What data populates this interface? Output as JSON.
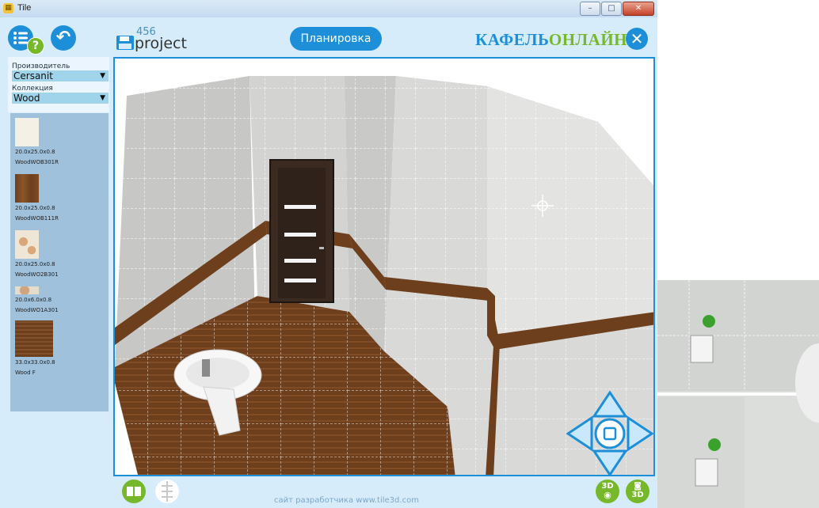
{
  "window": {
    "title": "Tile",
    "minimize_glyph": "–",
    "maximize_glyph": "□",
    "close_glyph": "✕",
    "icon": "tile-app-icon"
  },
  "toolbar": {
    "menu_icon": "list-menu-icon",
    "help_glyph": "?",
    "back_icon": "undo-arrow-icon",
    "back_glyph": "↶",
    "save_icon": "floppy-save-icon",
    "project_number": "456",
    "project_name": "project",
    "plan_button": "Планировка",
    "brand_part1": "КАФЕЛЬ",
    "brand_part2": "ОНЛАЙН",
    "close_icon": "close-circle-icon",
    "close_glyph": "✕"
  },
  "filters": {
    "manufacturer_label": "Производитель",
    "manufacturer_value": "Cersanit",
    "collection_label": "Коллекция",
    "collection_value": "Wood",
    "dropdown_glyph": "▼"
  },
  "tiles": [
    {
      "size": "20.0x25.0x0.8",
      "name": "WoodWOB301R",
      "color": "#f4f0e6"
    },
    {
      "size": "20.0x25.0x0.8",
      "name": "WoodWOB111R",
      "color": "#7a4a22"
    },
    {
      "size": "20.0x25.0x0.8",
      "name": "WoodWO2B301",
      "color": "#e8dcc6"
    },
    {
      "size": "20.0x6.0x0.8",
      "name": "WoodWO1A301",
      "color": "#e6dccc"
    },
    {
      "size": "33.0x33.0x0.8",
      "name": "Wood F",
      "color": "#7a4a22"
    }
  ],
  "viewport": {
    "description_icon": "3d-room-view",
    "nav_icon": "navigation-arrows-icon"
  },
  "bottom": {
    "footer_text": "сайт разработчика www.tile3d.com",
    "layout_icon": "tile-layout-icon",
    "grid_icon": "grid-toggle-icon",
    "view3d_label": "3D",
    "photo3d_label": "3D"
  },
  "colors": {
    "accent": "#1d8fd8",
    "green": "#77b82a",
    "brown": "#6e3f1c",
    "panel": "#d6ecfb"
  }
}
